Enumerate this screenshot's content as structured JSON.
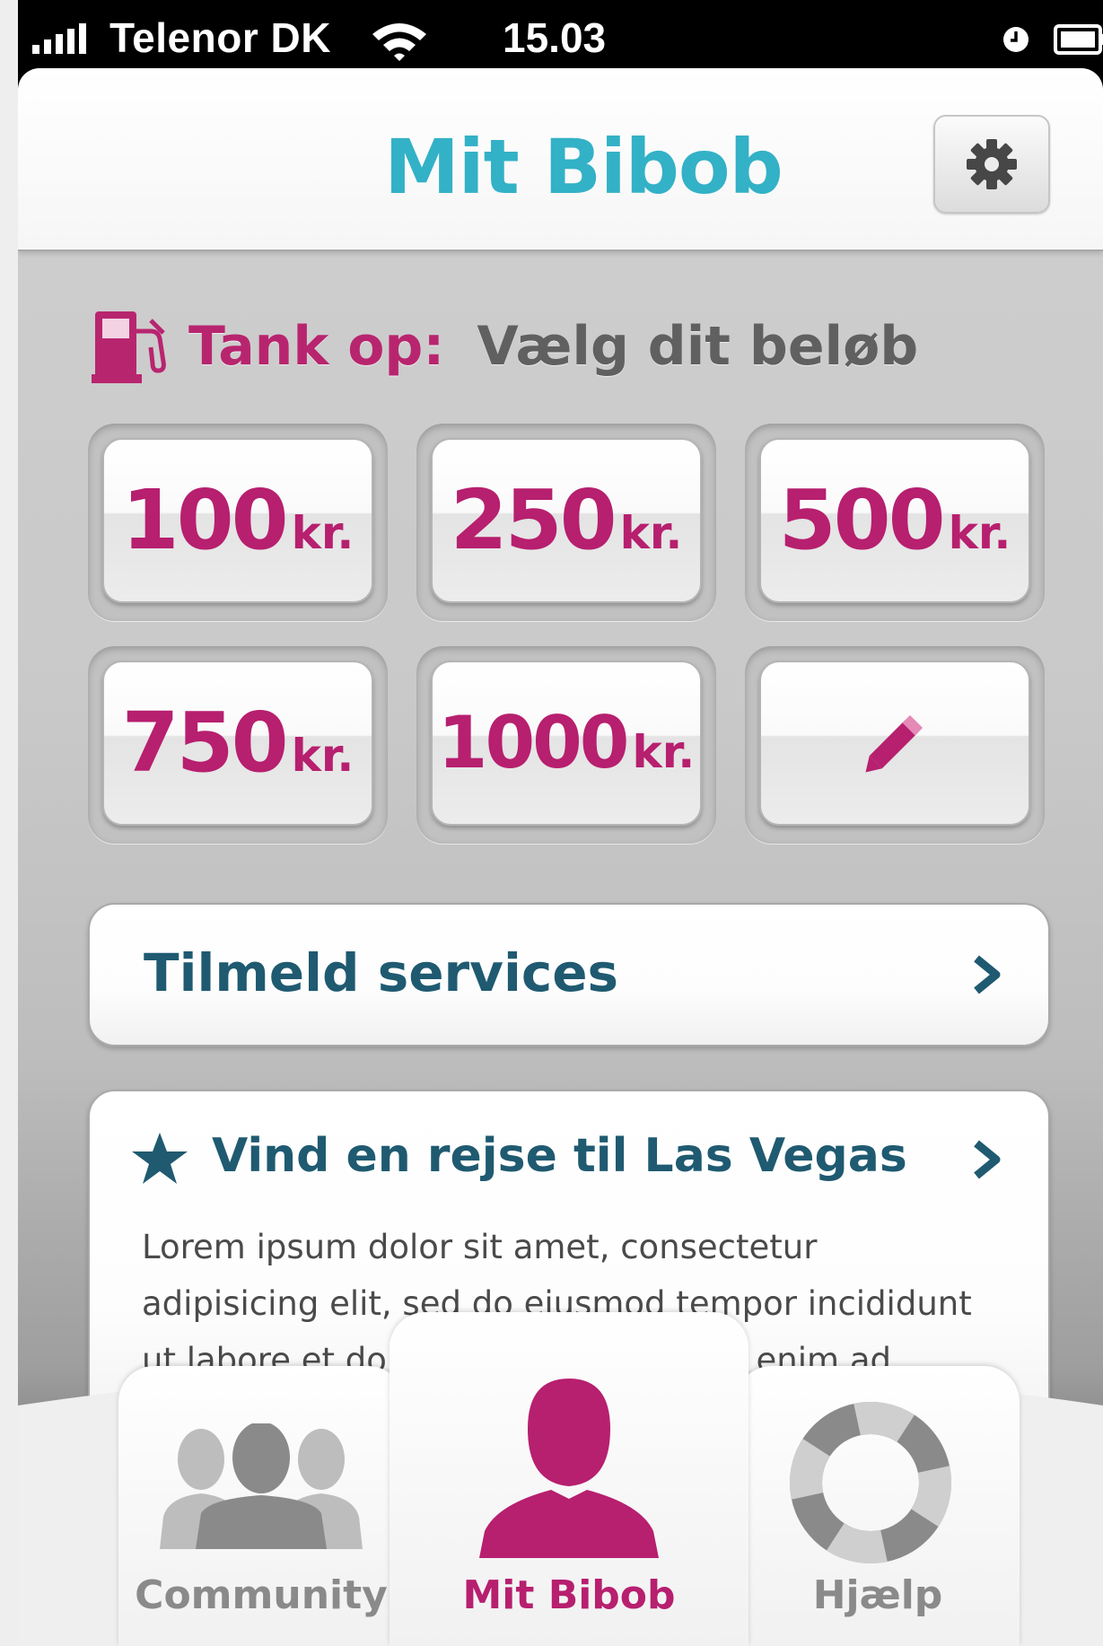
{
  "status_bar": {
    "carrier": "Telenor DK",
    "time": "15.03"
  },
  "nav": {
    "title": "Mit Bibob"
  },
  "tank": {
    "label": "Tank op:",
    "prompt": "Vælg dit beløb"
  },
  "amounts": [
    {
      "value": "100",
      "unit": "kr."
    },
    {
      "value": "250",
      "unit": "kr."
    },
    {
      "value": "500",
      "unit": "kr."
    },
    {
      "value": "750",
      "unit": "kr."
    },
    {
      "value": "1000",
      "unit": "kr."
    }
  ],
  "services": {
    "label": "Tilmeld services"
  },
  "promo": {
    "title": "Vind en rejse til Las Vegas",
    "body": "Lorem ipsum dolor sit amet, consectetur adipisicing elit, sed do eiusmod tempor incididunt ut labore et dolore magna aliqua. Ut enim ad minim veniam."
  },
  "tabs": [
    {
      "label": "Community"
    },
    {
      "label": "Mit Bibob"
    },
    {
      "label": "Hjælp"
    }
  ],
  "colors": {
    "brand_teal": "#33b1c6",
    "brand_magenta": "#b71f6f",
    "navy_text": "#1f5a71"
  }
}
